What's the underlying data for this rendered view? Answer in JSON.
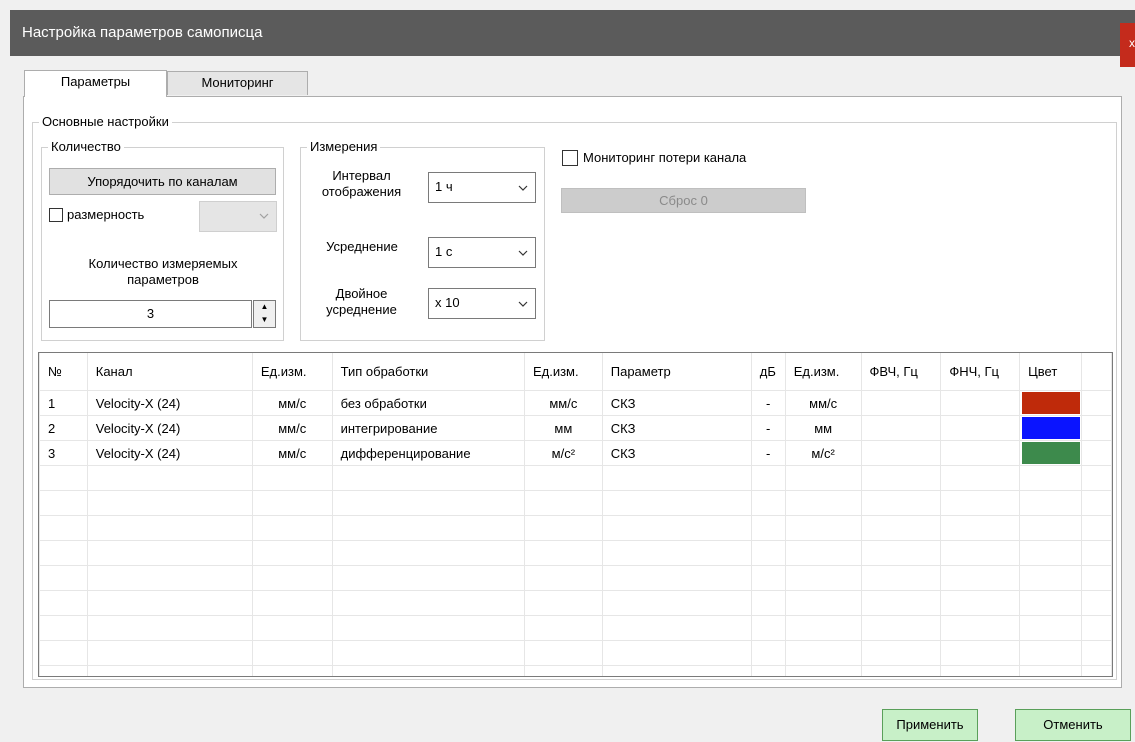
{
  "window": {
    "title": "Настройка параметров самописца",
    "close_glyph": "x"
  },
  "tabs": [
    {
      "label": "Параметры",
      "active": true
    },
    {
      "label": "Мониторинг",
      "active": false
    }
  ],
  "main_group": {
    "label": "Основные настройки"
  },
  "quantity_group": {
    "label": "Количество",
    "sort_button": "Упорядочить по каналам",
    "dimension_label": "размерность",
    "dimension_checked": false,
    "count_label": "Количество измеряемых параметров",
    "count_value": "3"
  },
  "measure_group": {
    "label": "Измерения",
    "interval_label": "Интервал отображения",
    "interval_value": "1 ч",
    "averaging_label": "Усреднение",
    "averaging_value": "1 с",
    "double_label": "Двойное усреднение",
    "double_value": "x 10"
  },
  "monitoring": {
    "label": "Мониторинг потери канала",
    "checked": false,
    "reset_button": "Сброс 0"
  },
  "table": {
    "headers": [
      "№",
      "Канал",
      "Ед.изм.",
      "Тип обработки",
      "Ед.изм.",
      "Параметр",
      "дБ",
      "Ед.изм.",
      "ФВЧ, Гц",
      "ФНЧ, Гц",
      "Цвет"
    ],
    "rows": [
      {
        "n": "1",
        "channel": "Velocity-X (24)",
        "unit1": "мм/с",
        "processing": "без обработки",
        "unit2": "мм/с",
        "param": "СКЗ",
        "db": "-",
        "unit3": "мм/с",
        "hpf": "",
        "lpf": "",
        "color": "#bf2a0a"
      },
      {
        "n": "2",
        "channel": "Velocity-X (24)",
        "unit1": "мм/с",
        "processing": "интегрирование",
        "unit2": "мм",
        "param": "СКЗ",
        "db": "-",
        "unit3": "мм",
        "hpf": "",
        "lpf": "",
        "color": "#0a14ff"
      },
      {
        "n": "3",
        "channel": "Velocity-X (24)",
        "unit1": "мм/с",
        "processing": "дифференцирование",
        "unit2": "м/с²",
        "param": "СКЗ",
        "db": "-",
        "unit3": "м/с²",
        "hpf": "",
        "lpf": "",
        "color": "#3d8a4c"
      }
    ]
  },
  "buttons": {
    "apply": "Применить",
    "cancel": "Отменить"
  },
  "colors": {
    "titlebar": "#5b5b5b",
    "close": "#c42b1c",
    "green_button": "#c8f0c8"
  }
}
